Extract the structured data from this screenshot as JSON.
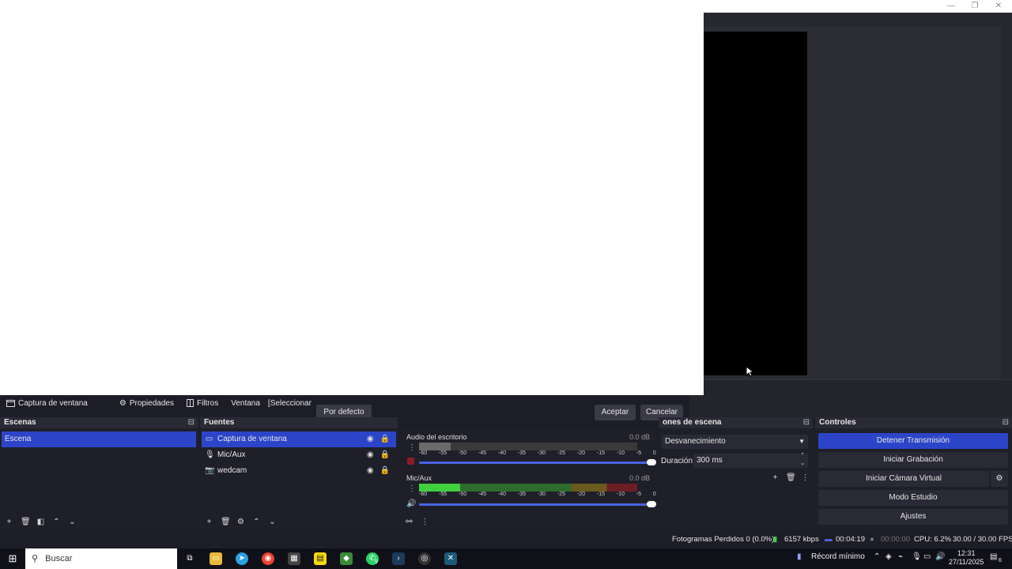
{
  "window": {
    "minimize": "—",
    "maximize": "❐",
    "close": "✕"
  },
  "source_toolbar": {
    "source_name": "Captura de ventana",
    "properties": "Propiedades",
    "filters": "Filtros",
    "window_label": "Ventana",
    "window_value": "[Seleccionar ve"
  },
  "dialog": {
    "default": "Por defecto",
    "accept": "Aceptar",
    "cancel": "Cancelar"
  },
  "scenes": {
    "title": "Escenas",
    "items": [
      {
        "label": "Escena"
      }
    ]
  },
  "sources": {
    "title": "Fuentes",
    "items": [
      {
        "label": "Captura de ventana",
        "icon": "window-capture-icon"
      },
      {
        "label": "Mic/Aux",
        "icon": "microphone-icon"
      },
      {
        "label": "wedcam",
        "icon": "camera-icon"
      }
    ]
  },
  "mixer": {
    "channels": [
      {
        "name": "Audio del escritorio",
        "db": "0.0 dB",
        "level": 0
      },
      {
        "name": "Mic/Aux",
        "db": "0.0 dB",
        "level": 0.19
      }
    ],
    "ticks": [
      "-60",
      "-55",
      "-50",
      "-45",
      "-40",
      "-35",
      "-30",
      "-25",
      "-20",
      "-15",
      "-10",
      "-5",
      "0"
    ]
  },
  "transitions": {
    "title": "ones de escena",
    "selected": "Desvanecimiento",
    "duration_label": "Duración",
    "duration_value": "300 ms"
  },
  "controls": {
    "title": "Controles",
    "stop_stream": "Detener Transmisión",
    "start_recording": "Iniciar Grabación",
    "start_virtual_cam": "Iniciar Cámara Virtual",
    "studio_mode": "Modo Estudio",
    "settings": "Ajustes"
  },
  "status": {
    "dropped_frames": "Fotogramas Perdidos 0 (0.0%)",
    "bitrate": "6157 kbps",
    "stream_time": "00:04:19",
    "rec_time": "00:00:00",
    "cpu": "CPU: 6.2%",
    "fps": "30.00 / 30.00 FPS"
  },
  "taskbar": {
    "search_placeholder": "Buscar",
    "whatsapp_badge": "9",
    "record_label": "Récord mínimo",
    "time": "12:31",
    "date": "27/11/2025",
    "notif_count": "6"
  },
  "colors": {
    "accent": "#2c45c8",
    "panel": "#1f1f29",
    "meter_green": "#3fcf3f"
  }
}
